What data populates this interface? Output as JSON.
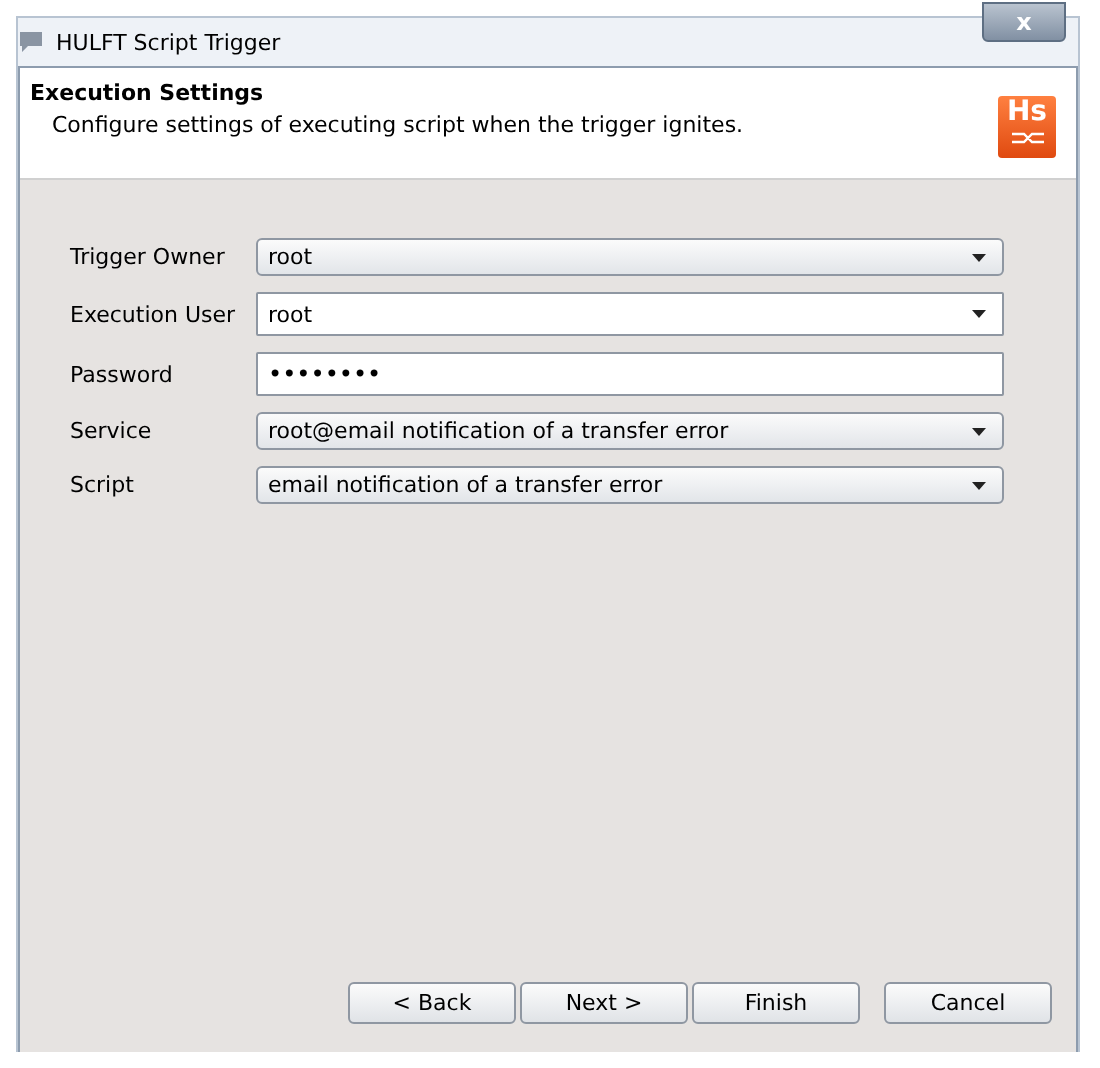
{
  "window": {
    "title": "HULFT Script Trigger",
    "close": "x"
  },
  "header": {
    "title": "Execution Settings",
    "description": "Configure settings of executing script when the trigger ignites.",
    "logo": "Hs"
  },
  "fields": [
    {
      "label": "Trigger Owner",
      "kind": "combo",
      "value": "root"
    },
    {
      "label": "Execution User",
      "kind": "editable",
      "value": "root"
    },
    {
      "label": "Password",
      "kind": "password",
      "value": "••••••••"
    },
    {
      "label": "Service",
      "kind": "combo",
      "value": "root@email notification of a transfer error"
    },
    {
      "label": "Script",
      "kind": "combo",
      "value": "email notification of a transfer error"
    }
  ],
  "buttons": [
    "< Back",
    "Next >",
    "Finish",
    "Cancel"
  ]
}
